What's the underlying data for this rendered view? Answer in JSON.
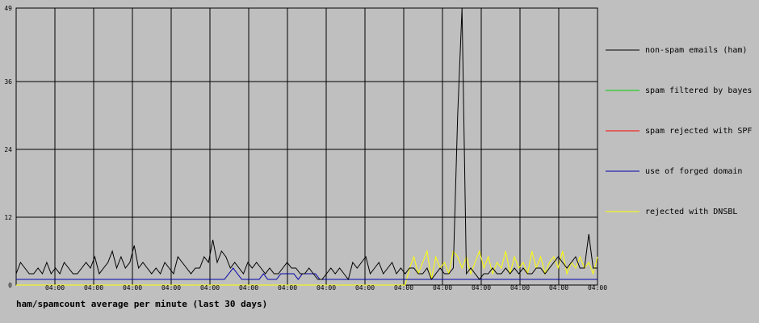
{
  "chart_data": {
    "type": "line",
    "title": "ham/spamcount average per minute (last 30 days)",
    "xlabel": "",
    "ylabel": "",
    "ylim": [
      0,
      49
    ],
    "y_ticks": [
      "0",
      "12",
      "24",
      "36",
      "49"
    ],
    "x_tick_labels": [
      "04:00",
      "04:00",
      "04:00",
      "04:00",
      "04:00",
      "04:00",
      "04:00",
      "04:00",
      "04:00",
      "04:00",
      "04:00",
      "04:00",
      "04:00",
      "04:00",
      "04:00"
    ],
    "grid": true,
    "legend_position": "right",
    "series": [
      {
        "name": "non-spam emails (ham)",
        "color": "#000000",
        "values": [
          2,
          4,
          3,
          2,
          2,
          3,
          2,
          4,
          2,
          3,
          2,
          4,
          3,
          2,
          2,
          3,
          4,
          3,
          5,
          2,
          3,
          4,
          6,
          3,
          5,
          3,
          4,
          7,
          3,
          4,
          3,
          2,
          3,
          2,
          4,
          3,
          2,
          5,
          4,
          3,
          2,
          3,
          3,
          5,
          4,
          8,
          4,
          6,
          5,
          3,
          4,
          3,
          2,
          4,
          3,
          4,
          3,
          2,
          3,
          2,
          2,
          3,
          4,
          3,
          3,
          2,
          2,
          3,
          2,
          1,
          1,
          2,
          3,
          2,
          3,
          2,
          1,
          4,
          3,
          4,
          5,
          2,
          3,
          4,
          2,
          3,
          4,
          2,
          3,
          2,
          3,
          3,
          2,
          2,
          3,
          1,
          2,
          3,
          2,
          2,
          3,
          30,
          49,
          2,
          3,
          2,
          1,
          2,
          2,
          3,
          2,
          2,
          3,
          2,
          3,
          2,
          3,
          2,
          2,
          3,
          3,
          2,
          3,
          4,
          5,
          4,
          3,
          4,
          5,
          3,
          3,
          9,
          3,
          3
        ]
      },
      {
        "name": "spam filtered by bayes",
        "color": "#00cc00",
        "values": []
      },
      {
        "name": "spam rejected with SPF",
        "color": "#ff0000",
        "values": []
      },
      {
        "name": "use of forged domain",
        "color": "#0000aa",
        "values": [
          1,
          1,
          1,
          1,
          1,
          1,
          1,
          1,
          1,
          1,
          1,
          1,
          1,
          1,
          1,
          1,
          1,
          1,
          1,
          1,
          1,
          1,
          1,
          1,
          1,
          1,
          1,
          1,
          1,
          1,
          1,
          1,
          1,
          1,
          1,
          1,
          1,
          1,
          1,
          1,
          1,
          1,
          1,
          1,
          1,
          1,
          1,
          1,
          1,
          2,
          3,
          2,
          1,
          1,
          1,
          1,
          1,
          2,
          1,
          1,
          1,
          2,
          2,
          2,
          2,
          1,
          2,
          2,
          2,
          2,
          1,
          1,
          1,
          1,
          1,
          1,
          1,
          1,
          1,
          1,
          1,
          1,
          1,
          1,
          1,
          1,
          1,
          1,
          1,
          1,
          1,
          1,
          1,
          1,
          1,
          1,
          1,
          1,
          1,
          1,
          1,
          1,
          1,
          1,
          1,
          1,
          1,
          1,
          1,
          1,
          1,
          1,
          1,
          1,
          1,
          1,
          1,
          1,
          1,
          1,
          1,
          1,
          1,
          1,
          1,
          1,
          1,
          1,
          1,
          1,
          1,
          1,
          1,
          1,
          1
        ]
      },
      {
        "name": "rejected with DNSBL",
        "color": "#ffff00",
        "values": [
          0,
          0,
          0,
          0,
          0,
          0,
          0,
          0,
          0,
          0,
          0,
          0,
          0,
          0,
          0,
          0,
          0,
          0,
          0,
          0,
          0,
          0,
          0,
          0,
          0,
          0,
          0,
          0,
          0,
          0,
          0,
          0,
          0,
          0,
          0,
          0,
          0,
          0,
          0,
          0,
          0,
          0,
          0,
          0,
          0,
          0,
          0,
          0,
          0,
          0,
          0,
          0,
          0,
          0,
          0,
          0,
          0,
          0,
          0,
          0,
          0,
          0,
          0,
          0,
          0,
          0,
          0,
          0,
          0,
          0,
          0,
          0,
          0,
          0,
          0,
          0,
          0,
          0,
          0,
          0,
          0,
          0,
          0,
          0,
          0,
          0,
          0,
          0,
          0,
          0,
          3,
          5,
          2,
          4,
          6,
          1,
          5,
          3,
          4,
          2,
          6,
          5,
          3,
          5,
          2,
          4,
          6,
          3,
          5,
          2,
          4,
          3,
          6,
          2,
          5,
          3,
          4,
          2,
          6,
          3,
          5,
          2,
          4,
          5,
          3,
          6,
          2,
          4,
          3,
          5,
          3,
          4,
          2,
          5
        ]
      }
    ]
  }
}
